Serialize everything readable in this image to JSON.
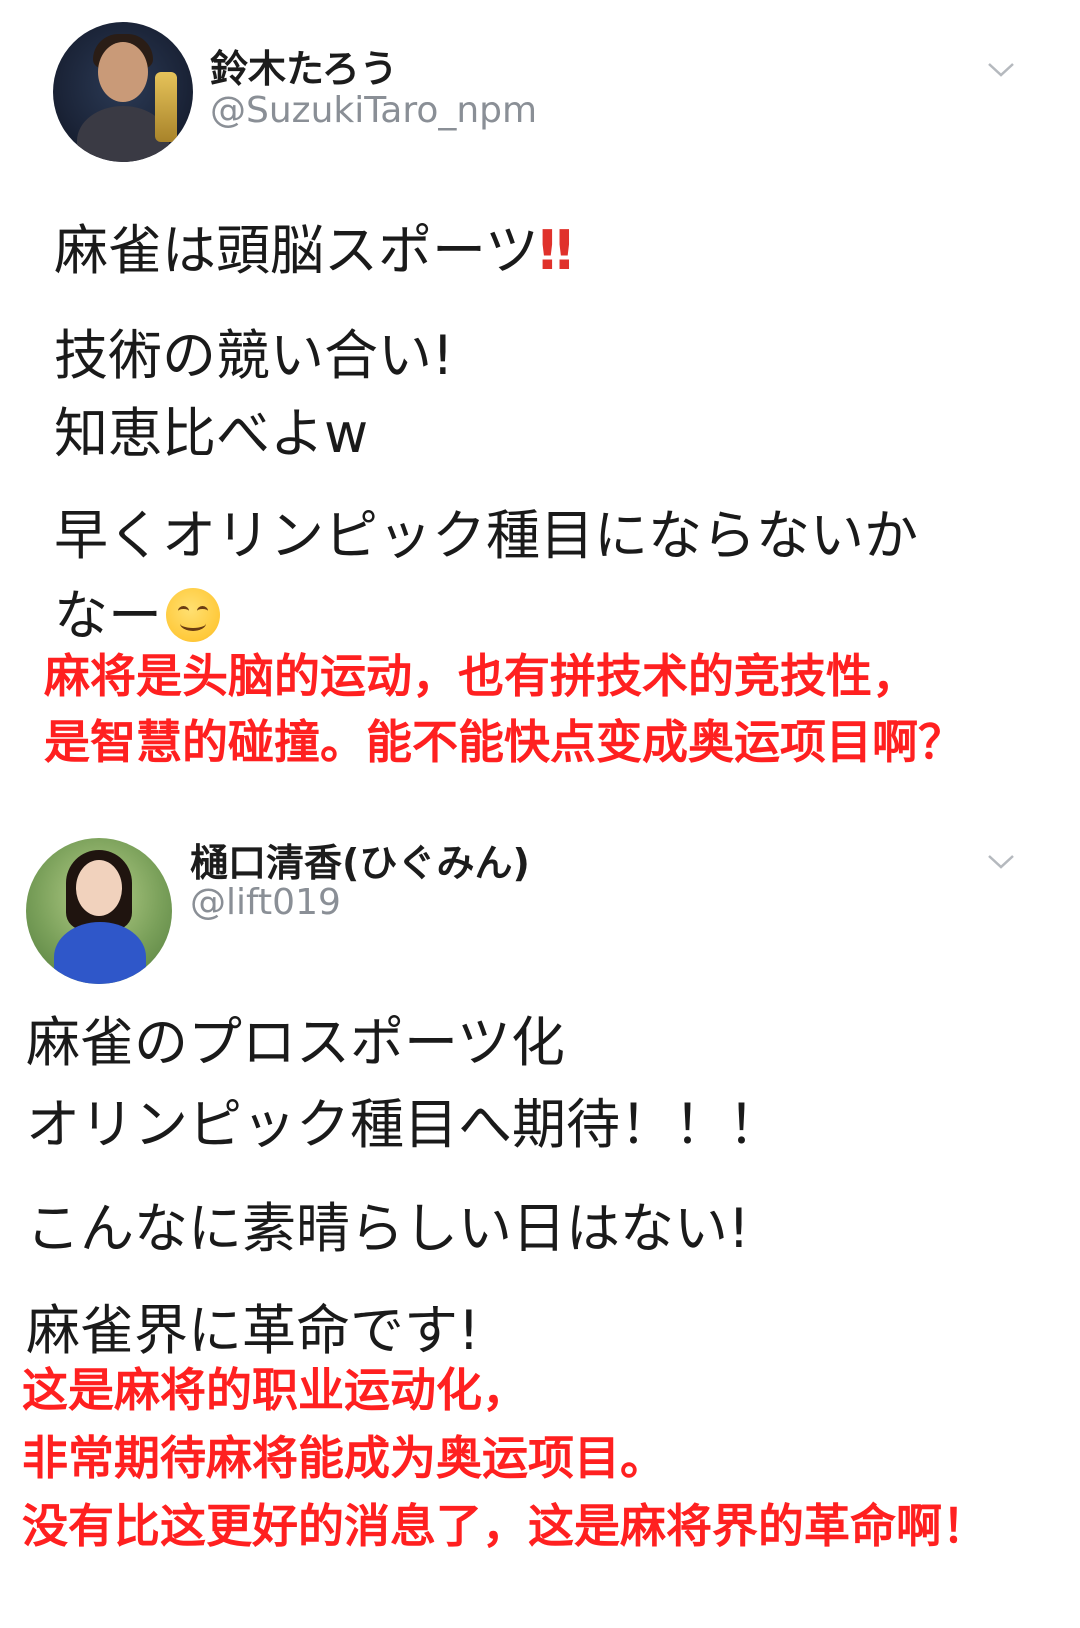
{
  "tweets": [
    {
      "display_name": "鈴木たろう",
      "handle": "@SuzukiTaro_npm",
      "menu_icon": "chevron-down-icon",
      "lines": [
        "麻雀は頭脳スポーツ",
        "技術の競い合い!",
        "知恵比べよw",
        "早くオリンピック種目にならないか",
        "なー"
      ],
      "emphasis": "‼",
      "emoji": "smiling-face-icon",
      "translation": [
        "麻将是头脑的运动，也有拼技术的竞技性，",
        "是智慧的碰撞。能不能快点变成奥运项目啊？"
      ]
    },
    {
      "display_name": "樋口清香(ひぐみん)",
      "handle": "@lift019",
      "menu_icon": "chevron-down-icon",
      "lines": [
        "麻雀のプロスポーツ化",
        "オリンピック種目へ期待！！！",
        "こんなに素晴らしい日はない!",
        "麻雀界に革命です!"
      ],
      "translation": [
        "这是麻将的职业运动化，",
        "非常期待麻将能成为奥运项目。",
        "没有比这更好的消息了，这是麻将界的革命啊！"
      ]
    }
  ],
  "colors": {
    "translation": "#ff2020",
    "handle": "#8a8f96",
    "emphasis": "#e0312b"
  }
}
